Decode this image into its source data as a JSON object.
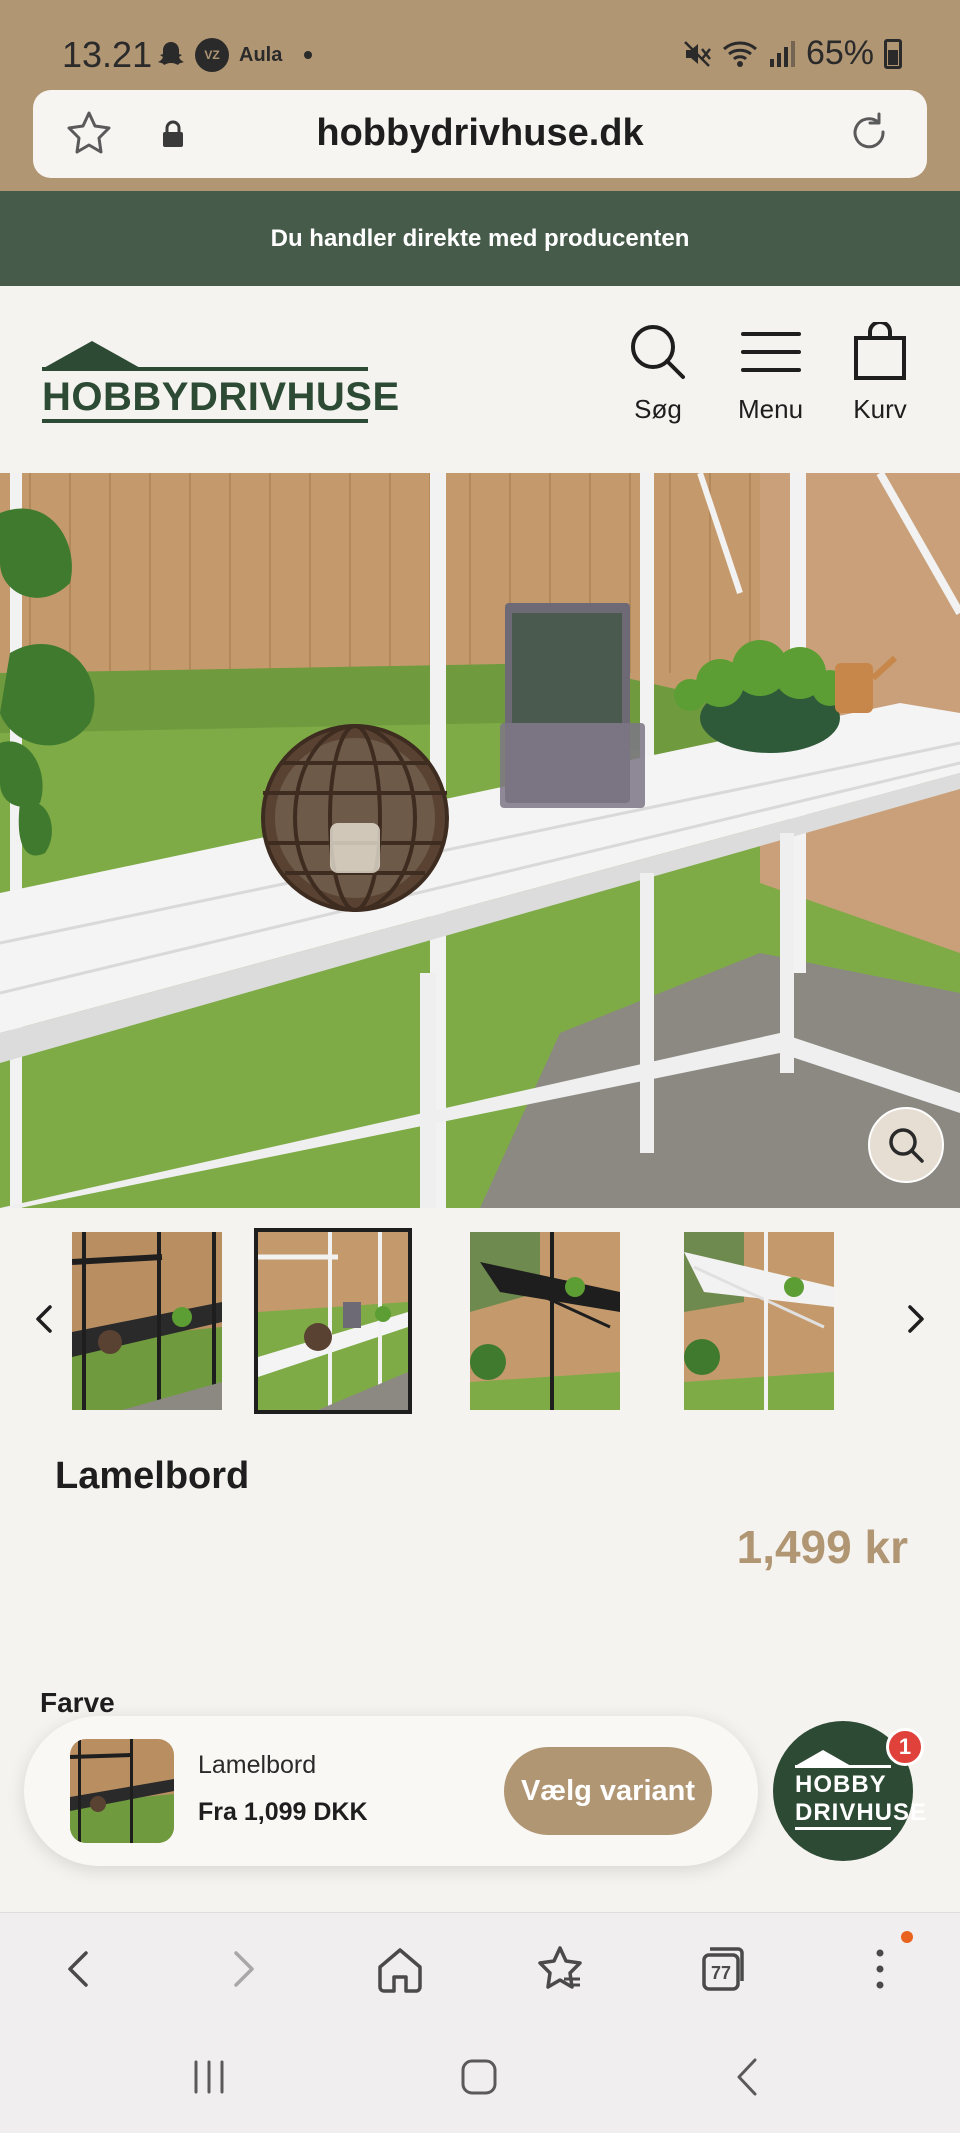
{
  "status_bar": {
    "time": "13.21",
    "notification_icons": [
      "snapchat-icon",
      "vz-icon",
      "aula-icon"
    ],
    "vz_label": "VZ",
    "aula_label": "Aula",
    "battery": "65%"
  },
  "url_bar": {
    "domain": "hobbydrivhuse.dk"
  },
  "announcement": "Du handler direkte med producenten",
  "header": {
    "logo_text": "HOBBYDRIVHUSE",
    "search_label": "Søg",
    "menu_label": "Menu",
    "cart_label": "Kurv"
  },
  "product": {
    "title": "Lamelbord",
    "price": "1,499 kr",
    "color_label": "Farve",
    "thumbnail_count": 4,
    "selected_thumbnail": 2
  },
  "sticky_bar": {
    "name": "Lamelbord",
    "price": "Fra 1,099 DKK",
    "button_label": "Vælg variant"
  },
  "chat_badge": {
    "line1": "HOBBY",
    "line2": "DRIVHUSE",
    "count": "1"
  },
  "browser_toolbar": {
    "tabs_count": "77"
  },
  "colors": {
    "brand_tan": "#b19674",
    "brand_green": "#475b4a",
    "logo_green": "#2d4a35",
    "notification_red": "#e0413a"
  }
}
